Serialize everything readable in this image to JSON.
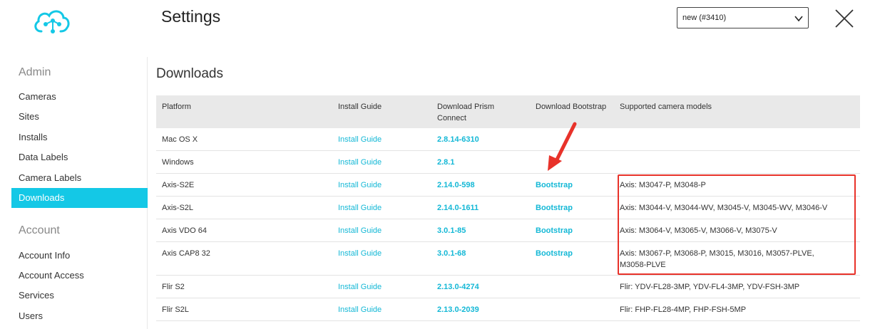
{
  "header": {
    "title": "Settings",
    "project_selected": "new (#3410)"
  },
  "sidebar": {
    "admin_heading": "Admin",
    "admin_items": [
      "Cameras",
      "Sites",
      "Installs",
      "Data Labels",
      "Camera Labels",
      "Downloads"
    ],
    "account_heading": "Account",
    "account_items": [
      "Account Info",
      "Account Access",
      "Services",
      "Users"
    ],
    "active": "Downloads"
  },
  "main": {
    "title": "Downloads",
    "columns": [
      "Platform",
      "Install Guide",
      "Download Prism Connect",
      "Download Bootstrap",
      "Supported camera models"
    ],
    "rows": [
      {
        "platform": "Mac OS X",
        "guide": "Install Guide",
        "prism": "2.8.14-6310",
        "bootstrap": "",
        "models": ""
      },
      {
        "platform": "Windows",
        "guide": "Install Guide",
        "prism": "2.8.1",
        "bootstrap": "",
        "models": ""
      },
      {
        "platform": "Axis-S2E",
        "guide": "Install Guide",
        "prism": "2.14.0-598",
        "bootstrap": "Bootstrap",
        "models": "Axis: M3047-P, M3048-P"
      },
      {
        "platform": "Axis-S2L",
        "guide": "Install Guide",
        "prism": "2.14.0-1611",
        "bootstrap": "Bootstrap",
        "models": "Axis: M3044-V, M3044-WV, M3045-V, M3045-WV, M3046-V"
      },
      {
        "platform": "Axis VDO 64",
        "guide": "Install Guide",
        "prism": "3.0.1-85",
        "bootstrap": "Bootstrap",
        "models": "Axis: M3064-V, M3065-V, M3066-V, M3075-V"
      },
      {
        "platform": "Axis CAP8 32",
        "guide": "Install Guide",
        "prism": "3.0.1-68",
        "bootstrap": "Bootstrap",
        "models": "Axis: M3067-P, M3068-P, M3015, M3016, M3057-PLVE, M3058-PLVE"
      },
      {
        "platform": "Flir S2",
        "guide": "Install Guide",
        "prism": "2.13.0-4274",
        "bootstrap": "",
        "models": "Flir: YDV-FL28-3MP, YDV-FL4-3MP, YDV-FSH-3MP"
      },
      {
        "platform": "Flir S2L",
        "guide": "Install Guide",
        "prism": "2.13.0-2039",
        "bootstrap": "",
        "models": "Flir: FHP-FL28-4MP, FHP-FSH-5MP"
      }
    ]
  },
  "colors": {
    "accent": "#14c8e6",
    "link": "#14b8d6",
    "annotation": "#e8322a"
  },
  "icons": {
    "logo": "cloud-network-logo",
    "close": "close-icon",
    "select": "chevron-down-icon",
    "annotation_arrow": "red-arrow-icon"
  }
}
